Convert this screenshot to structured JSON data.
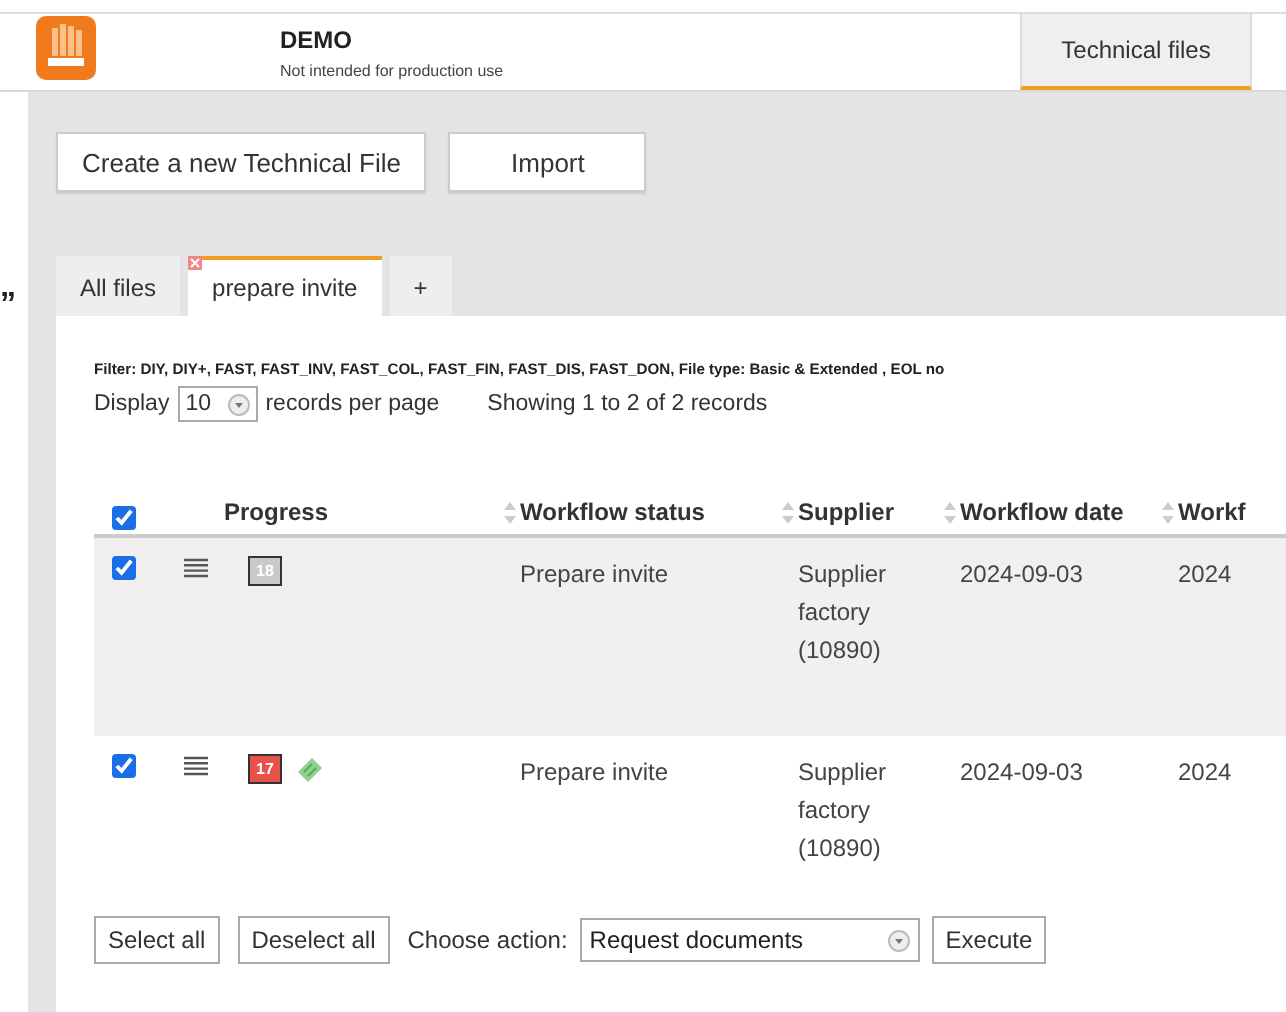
{
  "header": {
    "title": "DEMO",
    "subtitle": "Not intended for production use",
    "nav_tabs": [
      {
        "label": "Technical files",
        "selected": true
      }
    ]
  },
  "stray_mark": "”",
  "actions": [
    "Create a new Technical File",
    "Import"
  ],
  "tabs": [
    {
      "label": "All files",
      "selected": false,
      "closable": false
    },
    {
      "label": "prepare invite",
      "selected": true,
      "closable": true
    },
    {
      "label": "+",
      "selected": false,
      "closable": false
    }
  ],
  "filter": "Filter: DIY, DIY+, FAST, FAST_INV, FAST_COL, FAST_FIN, FAST_DIS, FAST_DON, File type: Basic & Extended , EOL no",
  "display": {
    "label": "Display",
    "value": "10",
    "suffix": "records per page",
    "info": "Showing 1 to 2 of 2 records"
  },
  "table": {
    "select_all_checked": true,
    "columns": [
      {
        "label": "Progress",
        "sortable": true
      },
      {
        "label": "Workflow status",
        "sortable": true
      },
      {
        "label": "Supplier",
        "sortable": true
      },
      {
        "label": "Workflow date",
        "sortable": true
      },
      {
        "label": "Workf",
        "sortable": false
      }
    ],
    "rows": [
      {
        "checked": true,
        "highlighted": true,
        "progress": "18",
        "color": "#c9c9c9",
        "ticket": false,
        "status": "Prepare invite",
        "supplier": "Supplier factory (10890)",
        "date": "2024-09-03",
        "column_5": "2024"
      },
      {
        "checked": true,
        "highlighted": false,
        "progress": "17",
        "color": "#e8504a",
        "ticket": true,
        "status": "Prepare invite",
        "supplier": "Supplier factory (10890)",
        "date": "2024-09-03",
        "column_5": "2024"
      }
    ]
  },
  "footer": {
    "select_all": "Select all",
    "deselect_all": "Deselect all",
    "action_label": "Choose action:",
    "action_value": "Request documents",
    "execute": "Execute"
  }
}
